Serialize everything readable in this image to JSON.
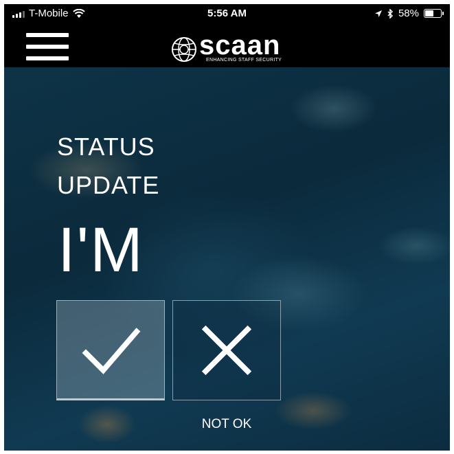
{
  "status_bar": {
    "carrier": "T-Mobile",
    "time": "5:56 AM",
    "battery": "58%",
    "battery_level": 0.58,
    "icons": [
      "signal-icon",
      "wifi-icon",
      "location-arrow-icon",
      "bluetooth-icon",
      "battery-icon"
    ]
  },
  "nav": {
    "menu_icon": "hamburger-menu-icon",
    "logo_word": "scaan",
    "logo_tagline": "ENHANCING STAFF SECURITY"
  },
  "main": {
    "title_line1": "STATUS",
    "title_line2": "UPDATE",
    "subject": "I'M",
    "ok_button_icon": "checkmark-icon",
    "not_ok_button_icon": "x-icon",
    "not_ok_label": "NOT OK"
  },
  "colors": {
    "bar_background": "#000000",
    "text": "#ffffff",
    "background": "#0d2a3c"
  }
}
